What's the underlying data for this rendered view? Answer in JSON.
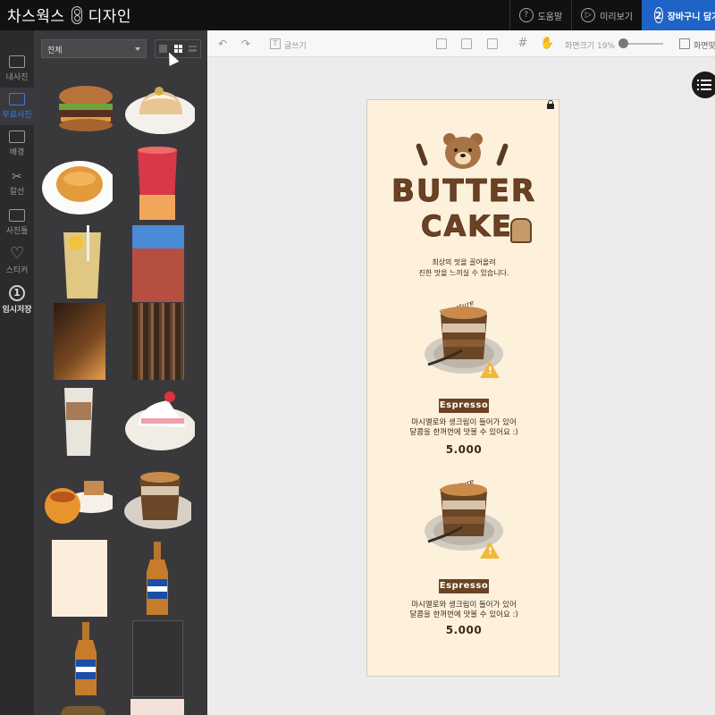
{
  "app": {
    "brand": "차스웍스",
    "brand_suffix": "디자인"
  },
  "header": {
    "help_label": "도움말",
    "preview_label": "미리보기",
    "cart_step": "2",
    "cart_label": "장바구니 담기"
  },
  "leftnav": {
    "items": [
      {
        "label": "내사진"
      },
      {
        "label": "무료사진"
      },
      {
        "label": "배경"
      },
      {
        "label": "칼선"
      },
      {
        "label": "사진틀"
      },
      {
        "label": "스티커"
      },
      {
        "label": "임시저장",
        "step": "1"
      }
    ]
  },
  "panel": {
    "filter_value": "전체"
  },
  "toolbar": {
    "text_label": "글쓰기",
    "zoom_label": "화면크기 19%",
    "zoom_value_percent": 19,
    "fit_label": "화면맞추기"
  },
  "design": {
    "title_line1": "BUTTER",
    "title_line2": "CAKE",
    "subtitle_line1": "최상의 맛을 끌어올려",
    "subtitle_line2": "진한 맛을 느끼실 수 있습니다.",
    "items": [
      {
        "signature": "Signature",
        "name": "Espresso",
        "desc_line1": "마시멜로와 생크림이 들어가 있어",
        "desc_line2": "달콤을 한꺼번에 맛볼 수 있어요 :)",
        "price": "5.000"
      },
      {
        "signature": "Signature",
        "name": "Espresso",
        "desc_line1": "마시멜로와 생크림이 들어가 있어",
        "desc_line2": "달콤을 한꺼번에 맛볼 수 있어요 :)",
        "price": "5.000"
      }
    ]
  },
  "colors": {
    "topbar": "#111111",
    "cart_accent": "#1f63c6",
    "nav_active": "#2f7fe8",
    "brown": "#6b4224",
    "paper": "#fdf1dc"
  }
}
